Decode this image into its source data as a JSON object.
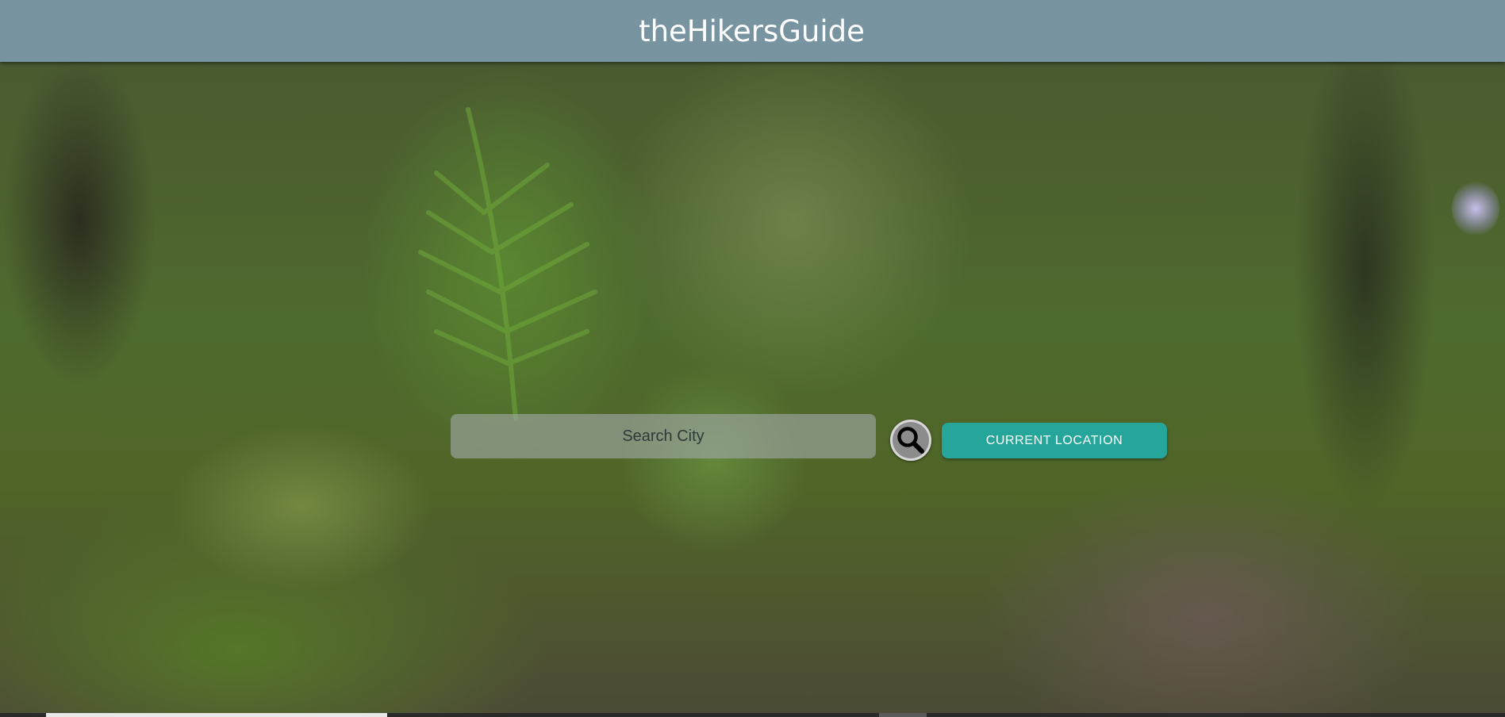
{
  "header": {
    "title": "theHikersGuide"
  },
  "search": {
    "placeholder": "Search City",
    "value": "",
    "search_button_icon": "search-icon",
    "current_location_label": "CURRENT LOCATION"
  },
  "colors": {
    "header_bg": "#7894a0",
    "accent": "#26a69a"
  }
}
